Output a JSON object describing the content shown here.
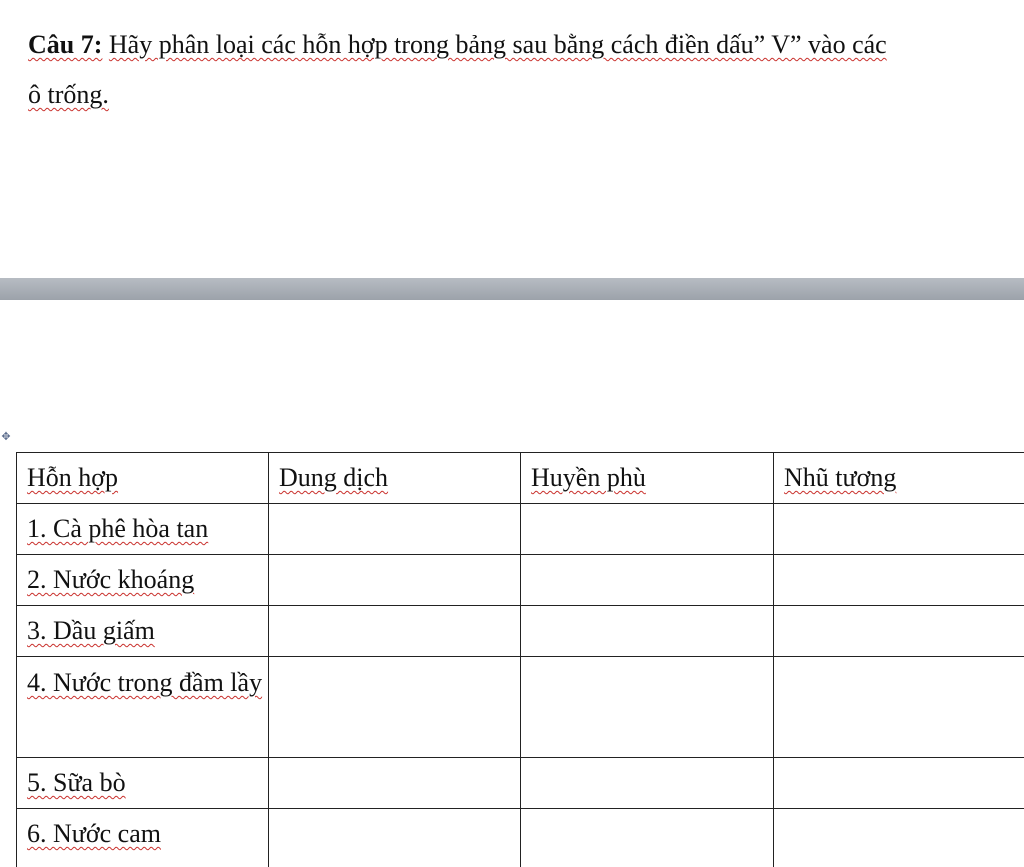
{
  "question": {
    "number_label": "Câu 7:",
    "line1": "Hãy phân loại các hỗn hợp trong bảng sau bằng cách điền dấu” V” vào các",
    "line2": "ô trống."
  },
  "table": {
    "headers": [
      "Hỗn hợp",
      "Dung dịch",
      "Huyền phù",
      "Nhũ tương"
    ],
    "rows": [
      {
        "label": "1. Cà phê hòa tan"
      },
      {
        "label": "2. Nước khoáng"
      },
      {
        "label": "3. Dầu giấm"
      },
      {
        "label": "4. Nước trong đầm lầy"
      },
      {
        "label": "5. Sữa bò"
      },
      {
        "label": "6. Nước cam"
      }
    ]
  },
  "icons": {
    "table_move_handle": "move-cross-icon"
  }
}
